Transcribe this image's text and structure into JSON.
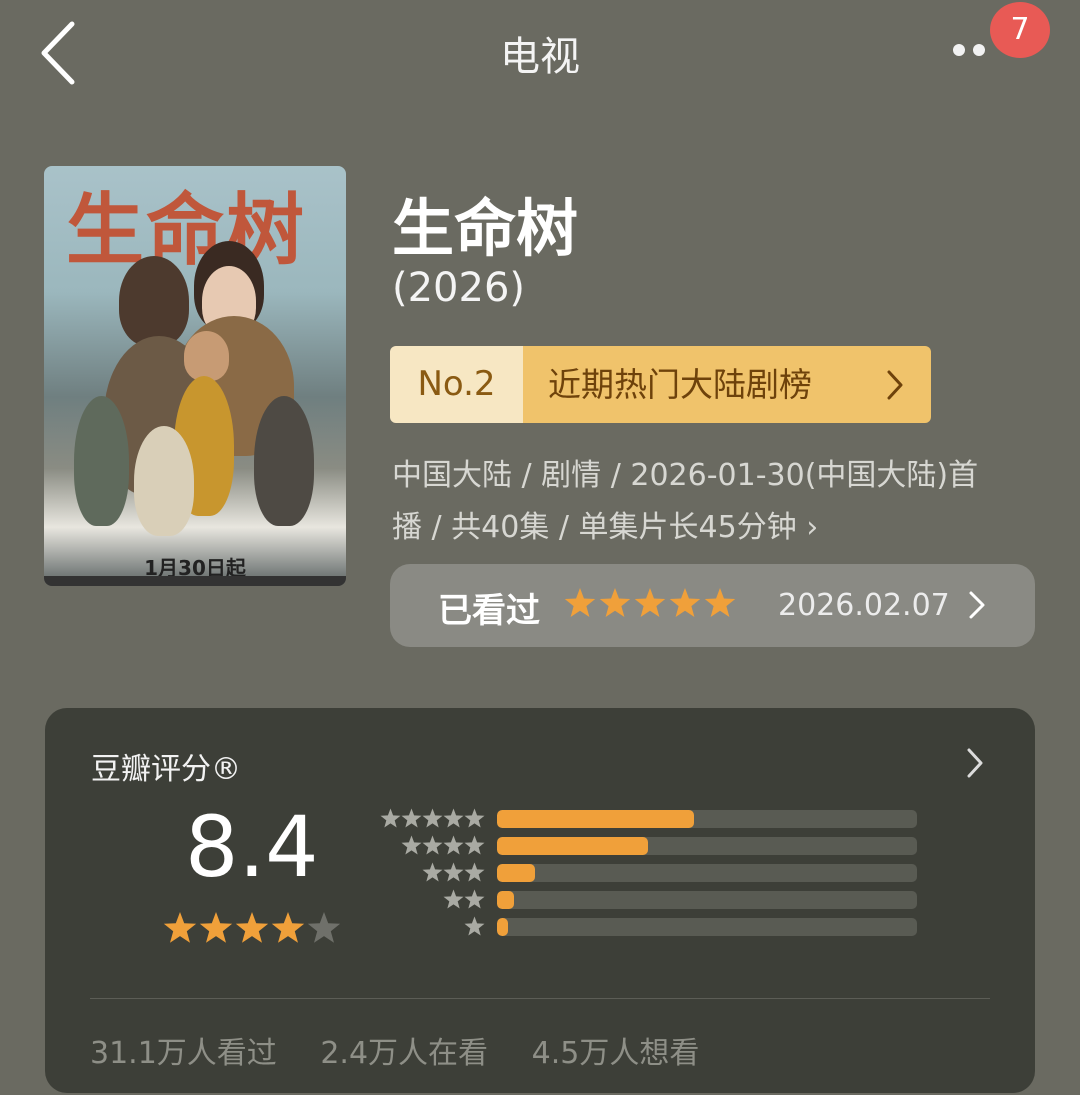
{
  "header": {
    "title": "电视",
    "back_icon": "chevron-left-icon",
    "more_icon": "more-dots-icon",
    "badge_count": "7",
    "badge_color": "#e85a55"
  },
  "poster": {
    "title_text": "生命树",
    "date_text": "1月30日起"
  },
  "show": {
    "name": "生命树",
    "year": "(2026)"
  },
  "rank": {
    "number": "No.2",
    "label": "近期热门大陆剧榜"
  },
  "meta": {
    "line1": "中国大陆 / 剧情 / 2026-01-30(中国大陆)首",
    "line2": "播 / 共40集 / 单集片长45分钟",
    "arrow": "›"
  },
  "watched": {
    "label": "已看过",
    "user_stars": 5,
    "date": "2026.02.07"
  },
  "douban": {
    "title": "豆瓣评分®",
    "score": "8.4",
    "stars": 4,
    "distribution": [
      {
        "stars": 5,
        "fraction": 0.47
      },
      {
        "stars": 4,
        "fraction": 0.36
      },
      {
        "stars": 3,
        "fraction": 0.09
      },
      {
        "stars": 2,
        "fraction": 0.04
      },
      {
        "stars": 1,
        "fraction": 0.025
      }
    ],
    "stats": {
      "watched": "31.1万人看过",
      "watching": "2.4万人在看",
      "want": "4.5万人想看"
    }
  },
  "colors": {
    "background": "#6a6a61",
    "accent": "#f0a03a",
    "rank_bg": "#f0c36b"
  }
}
